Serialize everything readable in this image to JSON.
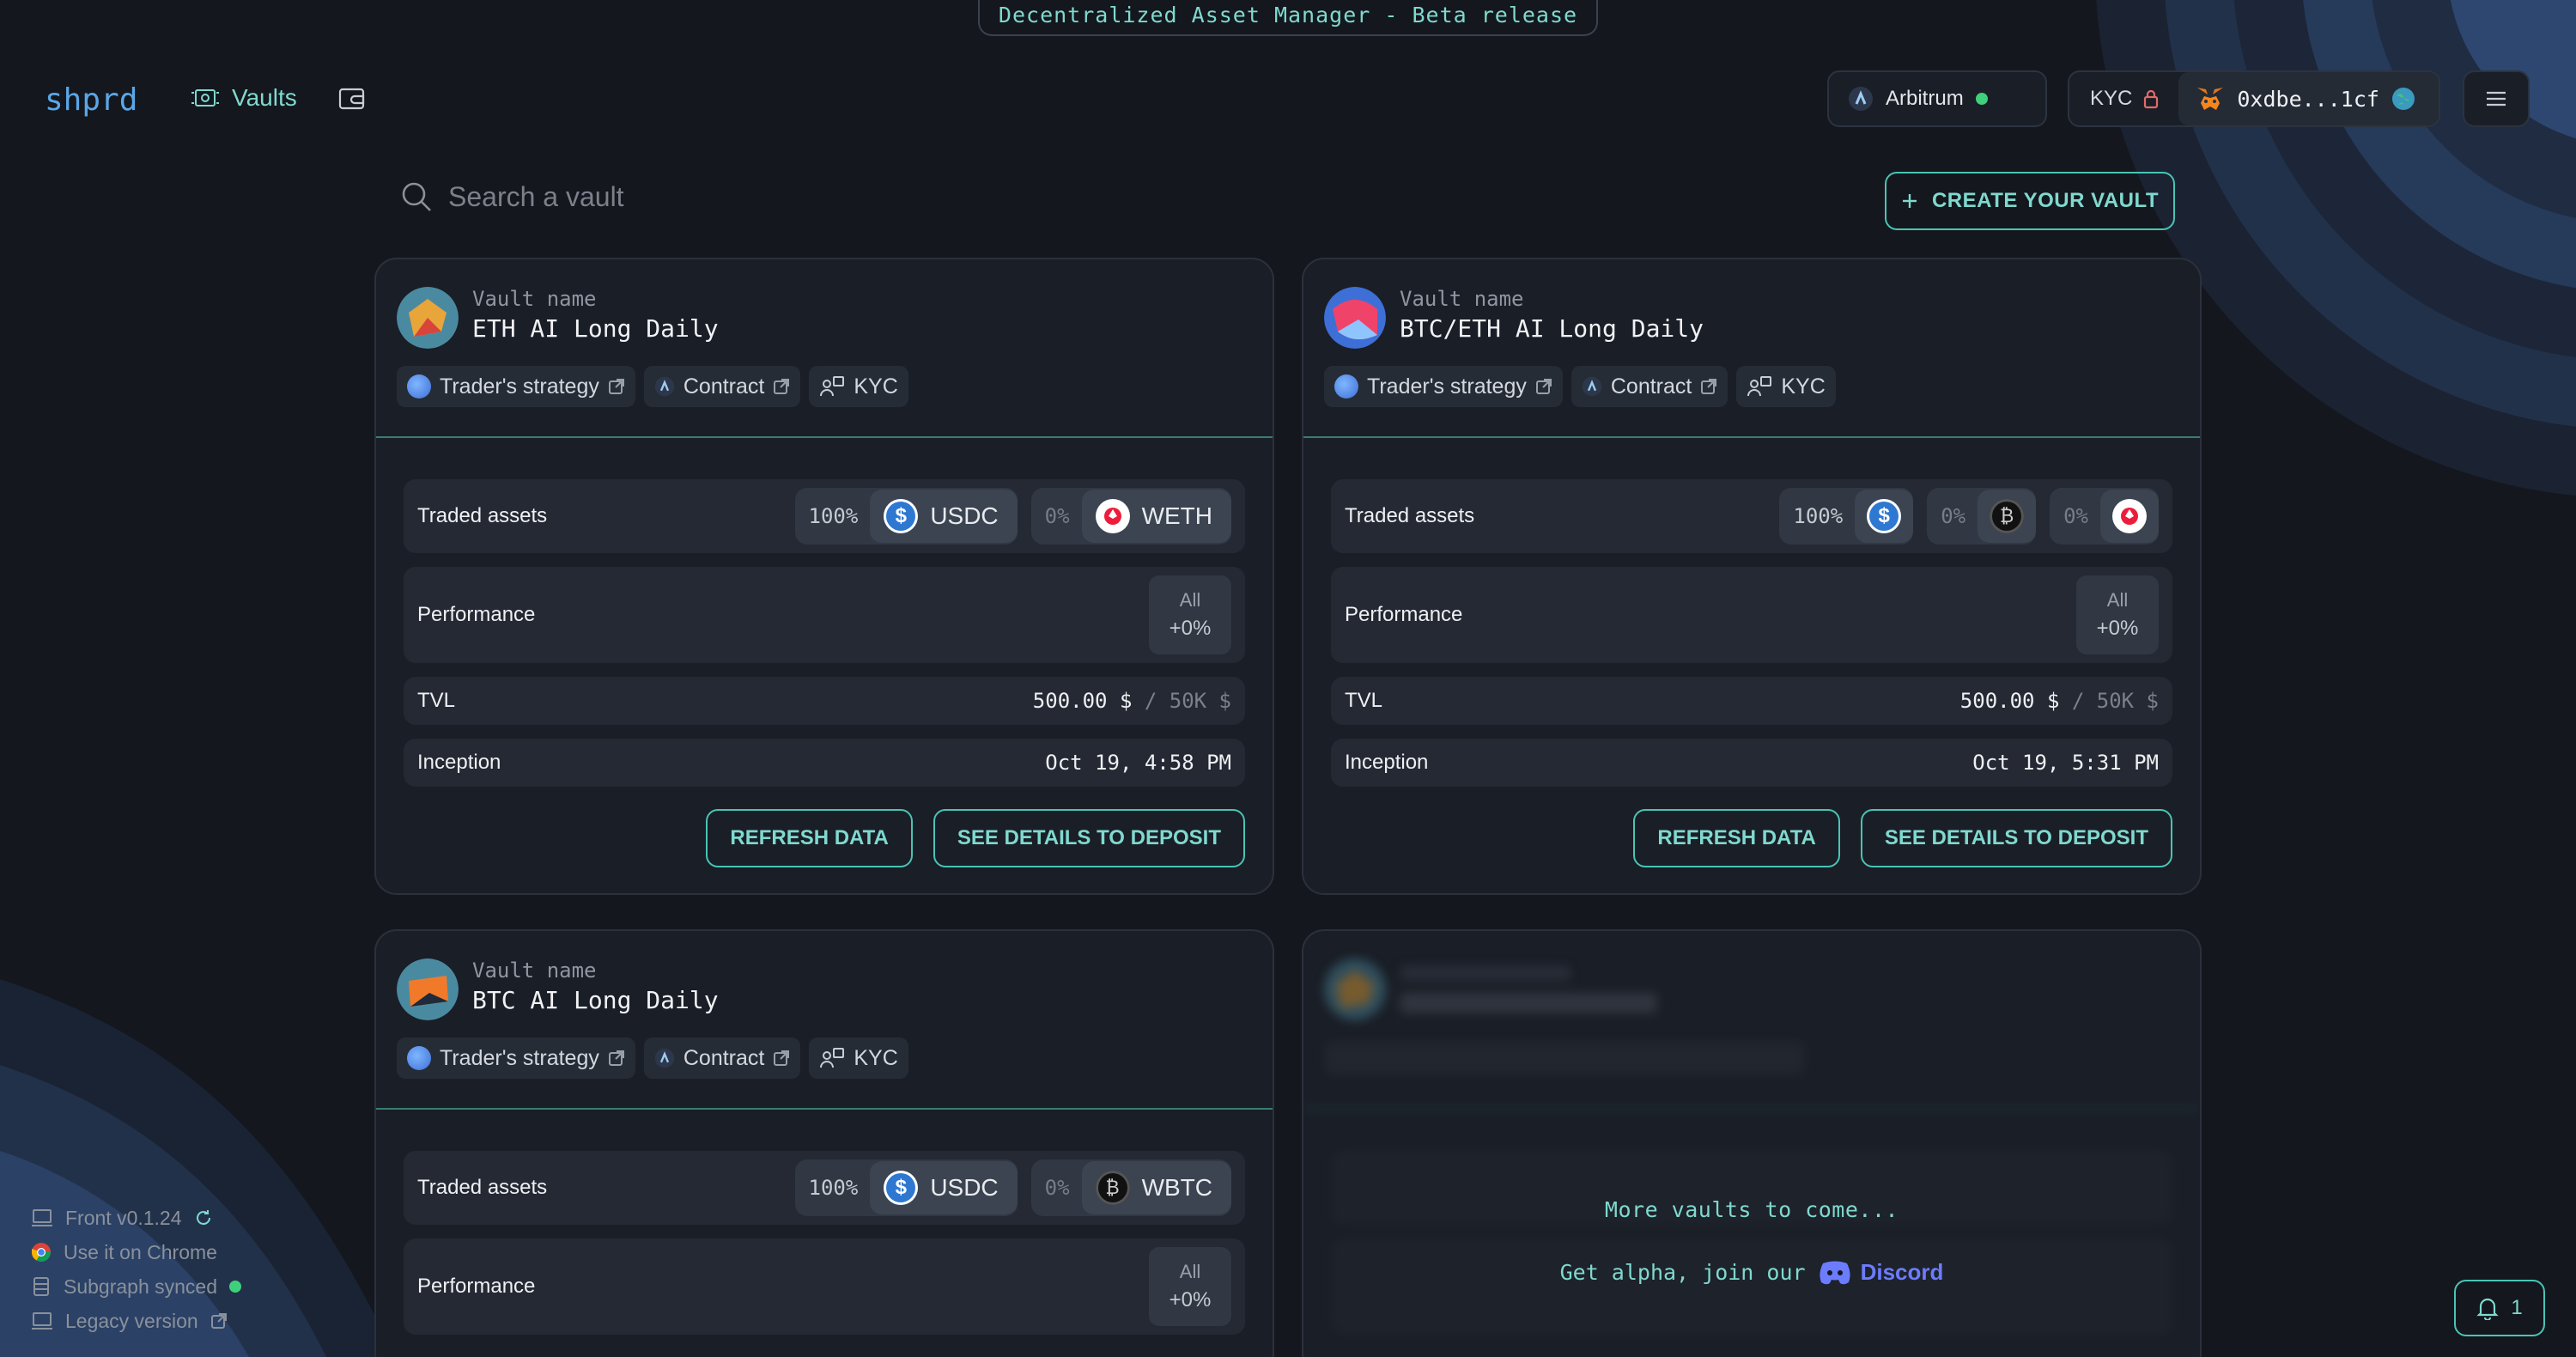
{
  "banner": "Decentralized Asset Manager - Beta release",
  "header": {
    "logo": "shprd",
    "nav_vaults": "Vaults",
    "network": "Arbitrum",
    "kyc_label": "KYC",
    "address": "0xdbe...1cf"
  },
  "search": {
    "placeholder": "Search a vault"
  },
  "create_button": "CREATE YOUR VAULT",
  "labels": {
    "vault_name": "Vault name",
    "traded_assets": "Traded assets",
    "performance": "Performance",
    "tvl": "TVL",
    "inception": "Inception",
    "all": "All",
    "refresh": "REFRESH DATA",
    "details": "SEE DETAILS TO DEPOSIT",
    "trader_strategy": "Trader's strategy",
    "contract": "Contract",
    "kyc": "KYC"
  },
  "vaults": [
    {
      "name": "ETH AI Long Daily",
      "assets": [
        {
          "pct": "100%",
          "symbol": "USDC",
          "icon": "usdc-icon"
        },
        {
          "pct": "0%",
          "symbol": "WETH",
          "icon": "weth-icon"
        }
      ],
      "performance": "+0%",
      "tvl_value": "500.00 $",
      "tvl_cap": "/ 50K $",
      "inception": "Oct 19, 4:58 PM"
    },
    {
      "name": "BTC/ETH AI Long Daily",
      "assets": [
        {
          "pct": "100%",
          "symbol": "",
          "icon": "usdc-icon"
        },
        {
          "pct": "0%",
          "symbol": "",
          "icon": "wbtc-icon"
        },
        {
          "pct": "0%",
          "symbol": "",
          "icon": "weth-icon"
        }
      ],
      "performance": "+0%",
      "tvl_value": "500.00 $",
      "tvl_cap": "/ 50K $",
      "inception": "Oct 19, 5:31 PM"
    },
    {
      "name": "BTC AI Long Daily",
      "assets": [
        {
          "pct": "100%",
          "symbol": "USDC",
          "icon": "usdc-icon"
        },
        {
          "pct": "0%",
          "symbol": "WBTC",
          "icon": "wbtc-icon"
        }
      ],
      "performance": "+0%"
    }
  ],
  "placeholder": {
    "more": "More vaults to come...",
    "alpha": "Get alpha, join our",
    "discord": "Discord"
  },
  "footer": {
    "version": "Front v0.1.24",
    "chrome": "Use it on Chrome",
    "subgraph": "Subgraph synced",
    "legacy": "Legacy version"
  },
  "notifications": {
    "count": "1"
  },
  "colors": {
    "accent": "#49c4b6",
    "accent_text": "#7fd9cf",
    "logo": "#5aa6e8",
    "status_ok": "#3fd07c",
    "discord": "#6c7cff"
  }
}
